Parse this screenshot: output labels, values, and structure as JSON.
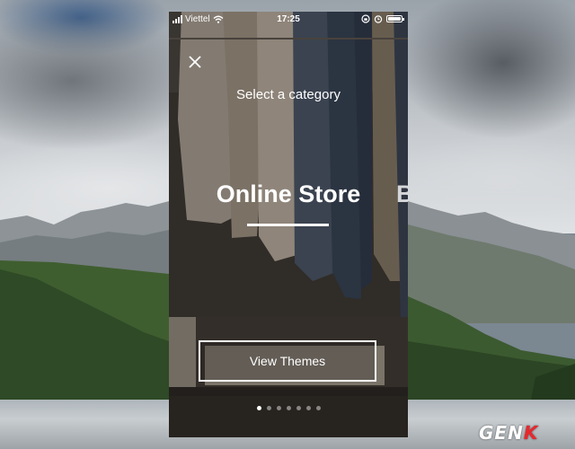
{
  "status_bar": {
    "carrier": "Viettel",
    "time": "17:25"
  },
  "screen": {
    "title": "Select a category",
    "current_category": "Online Store",
    "next_category_peek": "B",
    "view_themes_label": "View Themes",
    "page_dots": {
      "count": 7,
      "active_index": 0
    }
  },
  "watermark": {
    "text": "GENK"
  },
  "icons": [
    "signal-bars-icon",
    "wifi-icon",
    "rotation-lock-icon",
    "alarm-icon",
    "battery-icon",
    "close-icon"
  ]
}
